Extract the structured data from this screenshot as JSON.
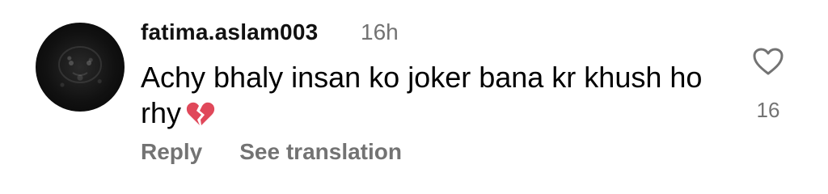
{
  "comment": {
    "author": "fatima.aslam003",
    "time_ago": "16h",
    "text": "Achy bhaly insan ko joker bana kr khush ho rhy",
    "emoji_icon": "broken-heart-icon",
    "actions": {
      "reply_label": "Reply",
      "translate_label": "See translation"
    },
    "likes": {
      "icon": "heart-outline-icon",
      "count": "16"
    }
  },
  "colors": {
    "text_primary": "#000000",
    "text_secondary": "#737373",
    "broken_heart": "#e0485a"
  }
}
